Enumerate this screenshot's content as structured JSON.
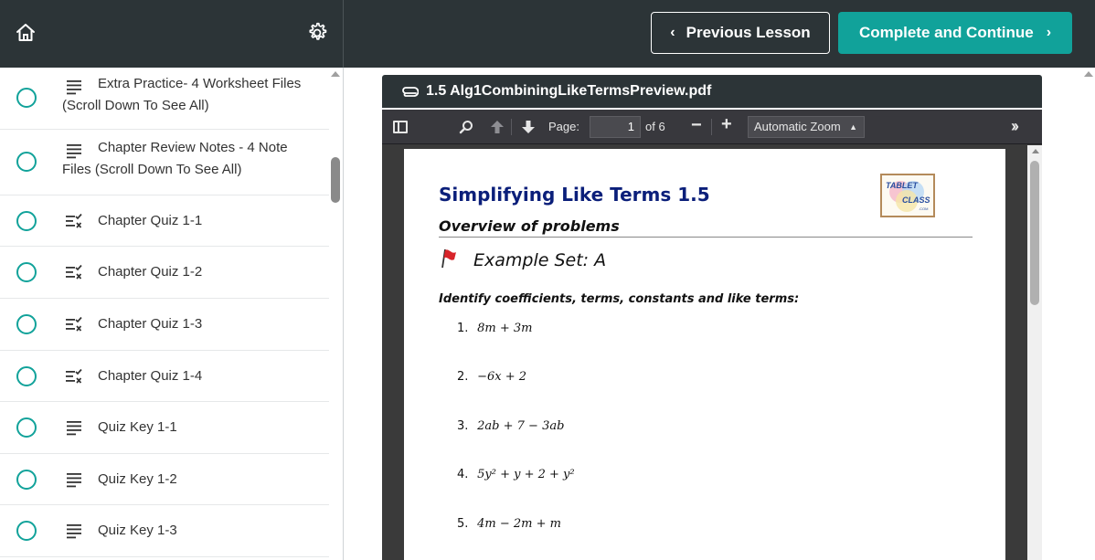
{
  "topbar": {
    "prev_label": "Previous Lesson",
    "next_label": "Complete and Continue"
  },
  "sidebar": {
    "items": [
      {
        "icon": "text-lines-icon",
        "text": "Extra Practice- 4 Worksheet Files (Scroll Down To See All)"
      },
      {
        "icon": "text-lines-icon",
        "text": "Chapter Review Notes - 4 Note Files (Scroll Down To See All)"
      },
      {
        "icon": "quiz-icon",
        "text": "Chapter Quiz 1-1"
      },
      {
        "icon": "quiz-icon",
        "text": "Chapter Quiz 1-2"
      },
      {
        "icon": "quiz-icon",
        "text": "Chapter Quiz 1-3"
      },
      {
        "icon": "quiz-icon",
        "text": "Chapter Quiz 1-4"
      },
      {
        "icon": "text-lines-icon",
        "text": "Quiz Key 1-1"
      },
      {
        "icon": "text-lines-icon",
        "text": "Quiz Key 1-2"
      },
      {
        "icon": "text-lines-icon",
        "text": "Quiz Key 1-3"
      }
    ]
  },
  "document": {
    "filename": "1.5 Alg1CombiningLikeTermsPreview.pdf"
  },
  "viewer": {
    "page_label": "Page:",
    "page_value": "1",
    "page_total": "of 6",
    "zoom": "Automatic Zoom"
  },
  "pdf": {
    "title": "Simplifying Like Terms 1.5",
    "logo_line1": "TABLET",
    "logo_line2": "CLASS",
    "logo_line3": ".COM",
    "subtitle": "Overview of problems",
    "example": "Example Set: A",
    "instruction": "Identify coefficients, terms, constants and like terms:",
    "problems": [
      {
        "num": "1.",
        "expr": "8m + 3m"
      },
      {
        "num": "2.",
        "expr": "−6x + 2"
      },
      {
        "num": "3.",
        "expr": "2ab + 7 − 3ab"
      },
      {
        "num": "4.",
        "expr": "5y² + y + 2 + y²"
      },
      {
        "num": "5.",
        "expr": "4m − 2m + m"
      }
    ]
  },
  "colors": {
    "topbar": "#2c3437",
    "accent": "#11a29a",
    "pdf_title": "#0b1f7a"
  }
}
